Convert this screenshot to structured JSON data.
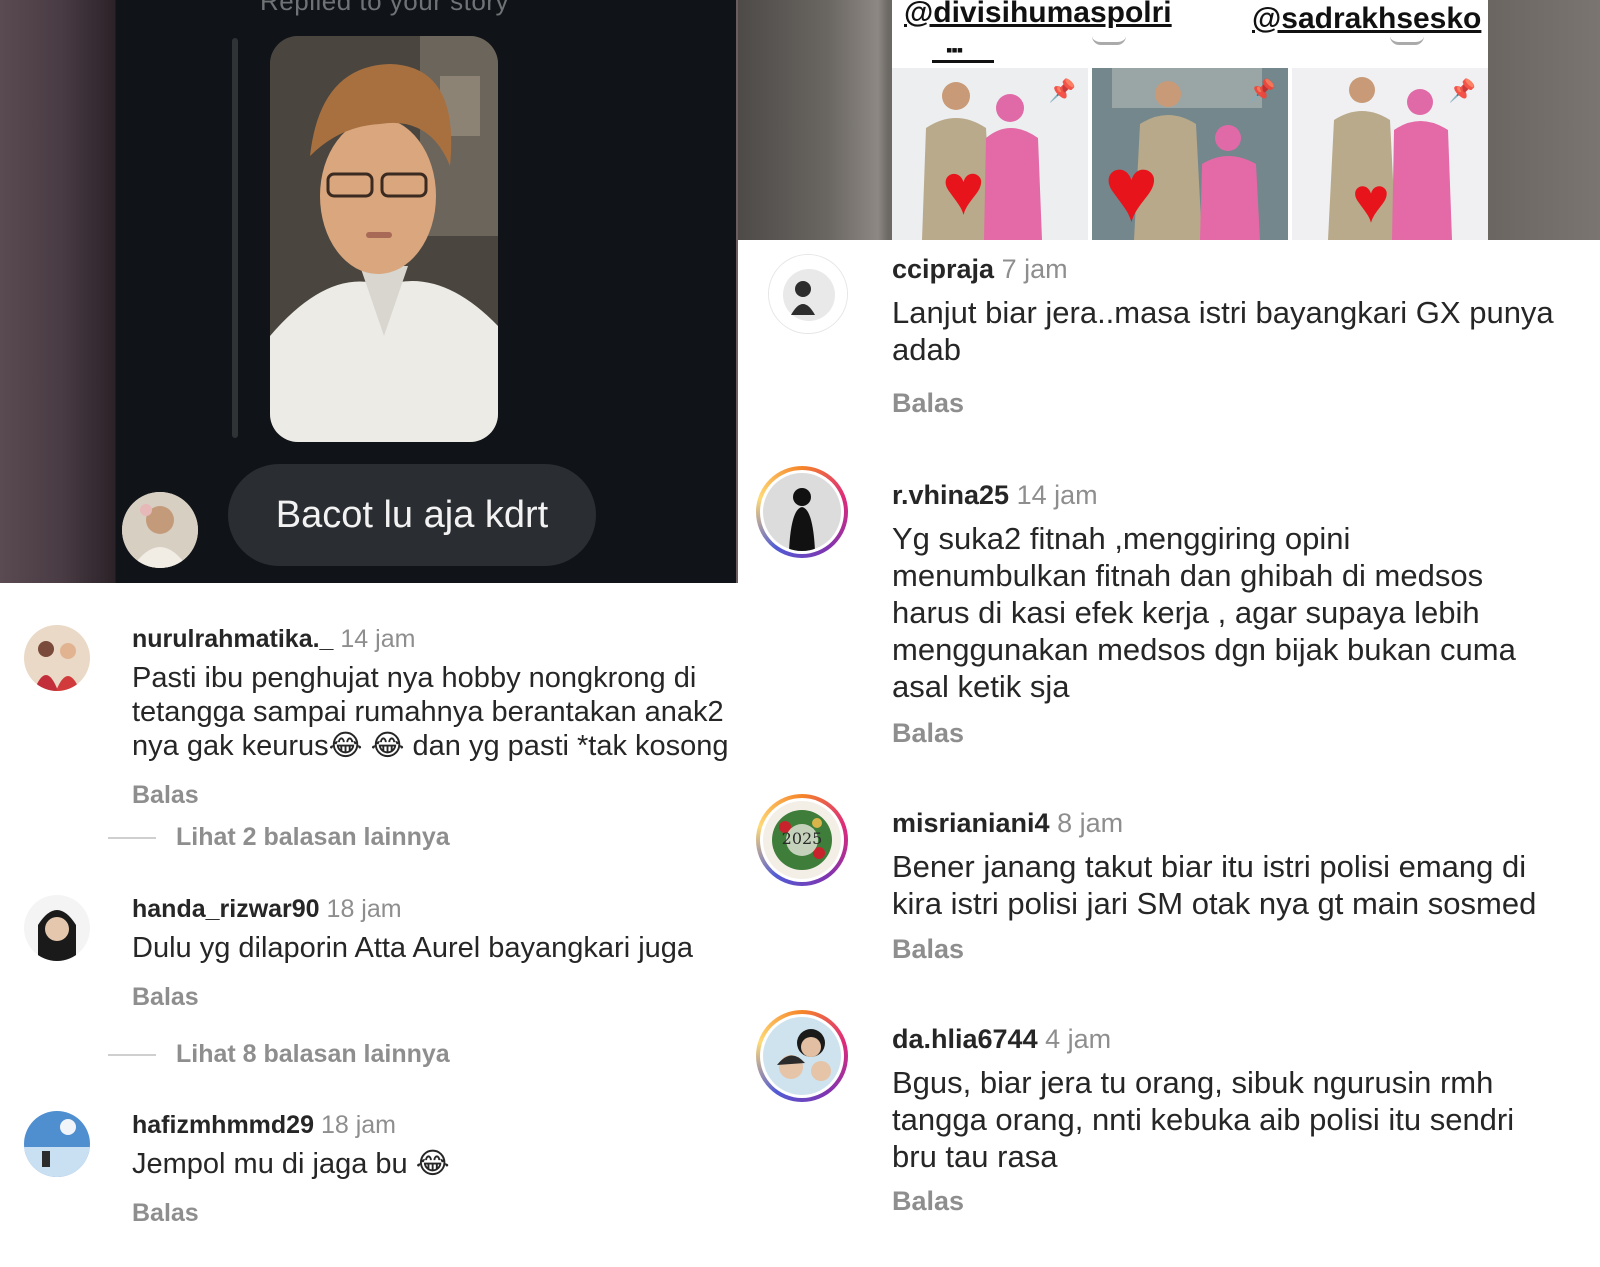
{
  "dm": {
    "replied_label": "Replied to your story",
    "message": "Bacot lu aja kdrt"
  },
  "post": {
    "tag_1": "@divisihumaspolri",
    "tag_2": "@sadrakhsesko",
    "grid_icon": "grid-icon",
    "pin_icon": "pin-icon",
    "heart_icon": "heart-icon"
  },
  "left_comments": [
    {
      "username": "nurulrahmatika._",
      "time": "14 jam",
      "lines": [
        "Pasti ibu penghujat nya hobby nongkrong di",
        "tetangga sampai rumahnya berantakan anak2",
        "nya gak keurus😂 😂  dan yg pasti *tak kosong"
      ],
      "reply_label": "Balas",
      "more_replies": "Lihat 2 balasan lainnya"
    },
    {
      "username": "handa_rizwar90",
      "time": "18 jam",
      "lines": [
        "Dulu yg dilaporin Atta Aurel bayangkari juga"
      ],
      "reply_label": "Balas",
      "more_replies": "Lihat 8 balasan lainnya"
    },
    {
      "username": "hafizmhmmd29",
      "time": "18 jam",
      "lines": [
        "Jempol mu di jaga bu 😂"
      ],
      "reply_label": "Balas"
    }
  ],
  "right_comments": [
    {
      "username": "ccipraja",
      "time": "7 jam",
      "lines": [
        "Lanjut biar jera..masa istri bayangkari GX punya",
        "adab"
      ],
      "reply_label": "Balas"
    },
    {
      "username": "r.vhina25",
      "time": "14 jam",
      "lines": [
        "Yg suka2 fitnah ,menggiring opini",
        "menumbulkan fitnah dan ghibah di medsos",
        "harus di kasi efek kerja , agar supaya lebih",
        "menggunakan medsos dgn bijak bukan cuma",
        "asal ketik sja"
      ],
      "reply_label": "Balas"
    },
    {
      "username": "misrianiani4",
      "time": "8 jam",
      "avatar_text": "2025",
      "lines": [
        "Bener janang takut biar itu istri polisi  emang di",
        "kira istri polisi jari SM otak nya  gt main sosmed"
      ],
      "reply_label": "Balas"
    },
    {
      "username": "da.hlia6744",
      "time": "4 jam",
      "lines": [
        "Bgus, biar jera tu orang, sibuk ngurusin rmh",
        "tangga orang, nnti kebuka aib polisi itu sendri",
        "bru tau rasa"
      ],
      "reply_label": "Balas"
    }
  ]
}
